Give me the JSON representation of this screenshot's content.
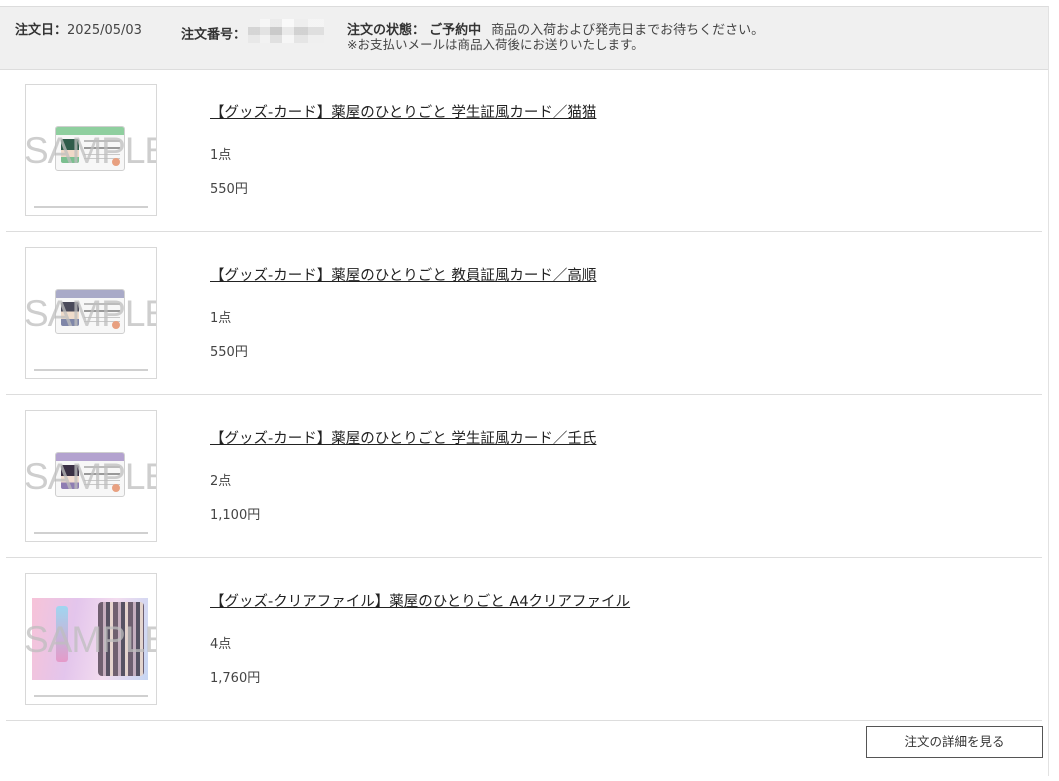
{
  "header": {
    "order_date_label": "注文日：",
    "order_date": "2025/05/03",
    "order_number_label": "注文番号：",
    "order_status_label": "注文の状態：",
    "order_status": "ご予約中",
    "status_message": "商品の入荷および発売日までお待ちください。",
    "payment_note": "※お支払いメールは商品入荷後にお送りいたします。"
  },
  "sample_watermark": "SAMPLE",
  "items": [
    {
      "title": "【グッズ-カード】薬屋のひとりごと 学生証風カード／猫猫",
      "quantity": "1点",
      "price": "550円",
      "image_kind": "id-card",
      "accent": "#8fcf9f"
    },
    {
      "title": "【グッズ-カード】薬屋のひとりごと 教員証風カード／高順",
      "quantity": "1点",
      "price": "550円",
      "image_kind": "id-card",
      "accent": "#a9aac8"
    },
    {
      "title": "【グッズ-カード】薬屋のひとりごと 学生証風カード／壬氏",
      "quantity": "2点",
      "price": "1,100円",
      "image_kind": "id-card",
      "accent": "#b3a2cf"
    },
    {
      "title": "【グッズ-クリアファイル】薬屋のひとりごと A4クリアファイル",
      "quantity": "4点",
      "price": "1,760円",
      "image_kind": "clear-file",
      "accent": "#f0c3da"
    }
  ],
  "footer": {
    "detail_button_label": "注文の詳細を見る"
  }
}
